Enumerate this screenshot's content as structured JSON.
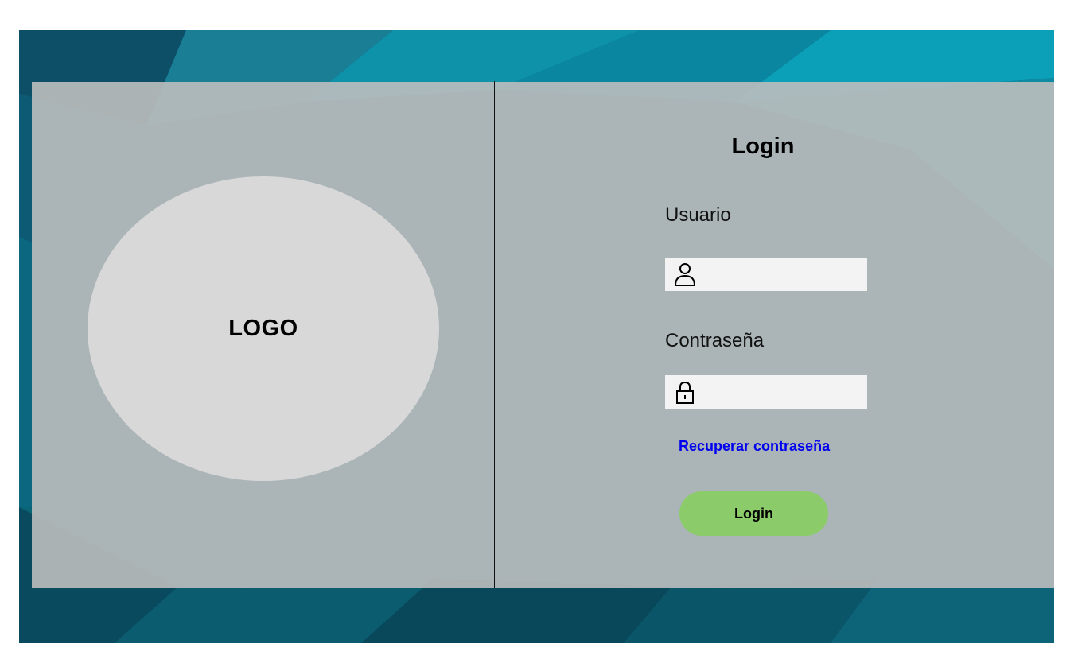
{
  "colors": {
    "background_dark": "#0b6c80",
    "panel": "#bcbebe",
    "logo_circle": "#d8d8d8",
    "input_bg": "#f3f3f3",
    "link": "#0000ee",
    "button": "#8bcb6a"
  },
  "logo": {
    "text": "LOGO"
  },
  "login_form": {
    "title": "Login",
    "username": {
      "label": "Usuario",
      "value": "",
      "placeholder": "",
      "icon": "user-icon"
    },
    "password": {
      "label": "Contraseña",
      "value": "",
      "placeholder": "",
      "icon": "lock-icon"
    },
    "recover_link": "Recuperar contraseña",
    "submit_label": "Login"
  }
}
